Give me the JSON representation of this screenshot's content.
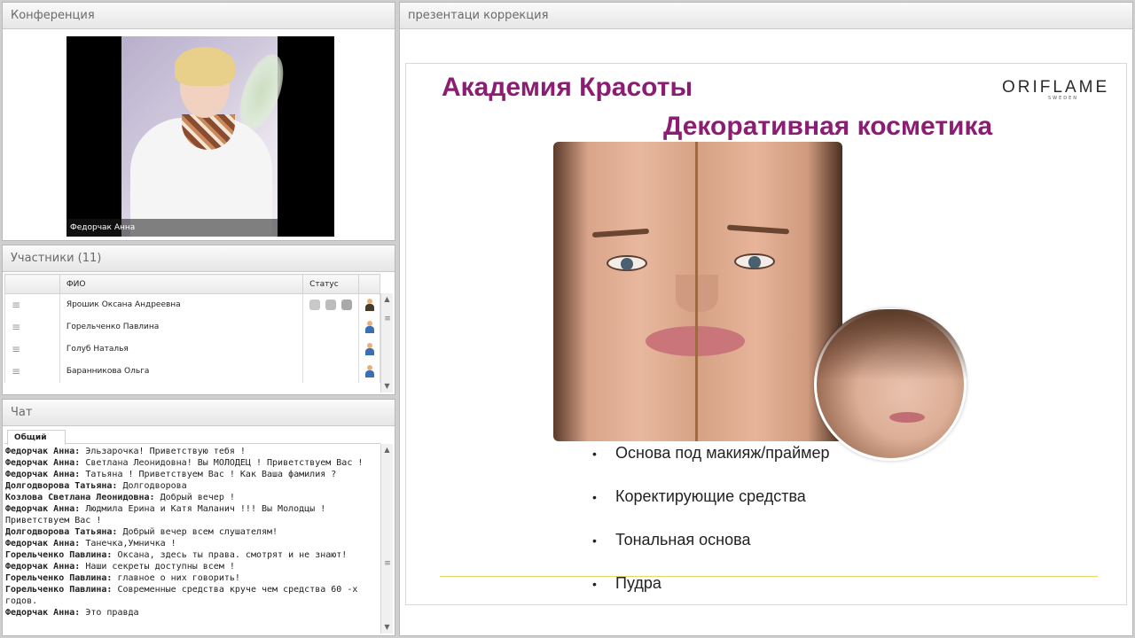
{
  "conference": {
    "title": "Конференция",
    "video_caption": "Федорчак Анна"
  },
  "participants": {
    "title": "Участники (11)",
    "columns": [
      "ФИО",
      "Статус"
    ],
    "rows": [
      {
        "name": "Ярошик Оксана Андреевна",
        "statuses": [
          "camera-off-icon",
          "mic-off-icon",
          "screen-off-icon"
        ]
      },
      {
        "name": "Горельченко Павлина",
        "statuses": []
      },
      {
        "name": "Голуб Наталья",
        "statuses": []
      },
      {
        "name": "Баранникова Ольга",
        "statuses": []
      }
    ]
  },
  "chat": {
    "title": "Чат",
    "tab": "Общий",
    "messages": [
      {
        "author": "Федорчак Анна:",
        "text": " Эльзарочка! Приветствую тебя !"
      },
      {
        "author": "Федорчак Анна:",
        "text": " Светлана Леонидовна! Вы МОЛОДЕЦ ! Приветствуем Вас !"
      },
      {
        "author": "Федорчак Анна:",
        "text": " Татьяна ! Приветствуем Вас ! Как Ваша фамилия ?"
      },
      {
        "author": "Долгодворова Татьяна:",
        "text": " Долгодворова"
      },
      {
        "author": "Козлова Светлана  Леонидовна:",
        "text": " Добрый вечер !"
      },
      {
        "author": "Федорчак Анна:",
        "text": " Людмила Ерина и Катя Маланич !!! Вы Молодцы ! Приветствуем Вас !"
      },
      {
        "author": "Долгодворова Татьяна:",
        "text": " Добрый вечер всем слушателям!"
      },
      {
        "author": "Федорчак Анна:",
        "text": " Танечка,Умничка !"
      },
      {
        "author": "Горельченко Павлина:",
        "text": " Оксана, здесь ты права. смотрят и не знают!"
      },
      {
        "author": "Федорчак Анна:",
        "text": " Наши секреты доступны всем !"
      },
      {
        "author": "Горельченко Павлина:",
        "text": " главное о них говорить!"
      },
      {
        "author": "Горельченко Павлина:",
        "text": " Современные средства круче чем средства 60 -х годов."
      },
      {
        "author": "Федорчак Анна:",
        "text": " Это правда"
      }
    ]
  },
  "presentation": {
    "title": "презентаци коррекция",
    "slide": {
      "heading1": "Академия  Красоты",
      "heading2": "Декоративная  косметика",
      "logo": "ORIFLAME",
      "logo_sub": "SWEDEN",
      "bullets": [
        "Основа под макияж/праймер",
        "Коректирующие средства",
        "Тональная основа",
        "Пудра"
      ]
    }
  },
  "colors": {
    "heading": "#8b1d73",
    "panel_header_text": "#6a6a6a"
  }
}
